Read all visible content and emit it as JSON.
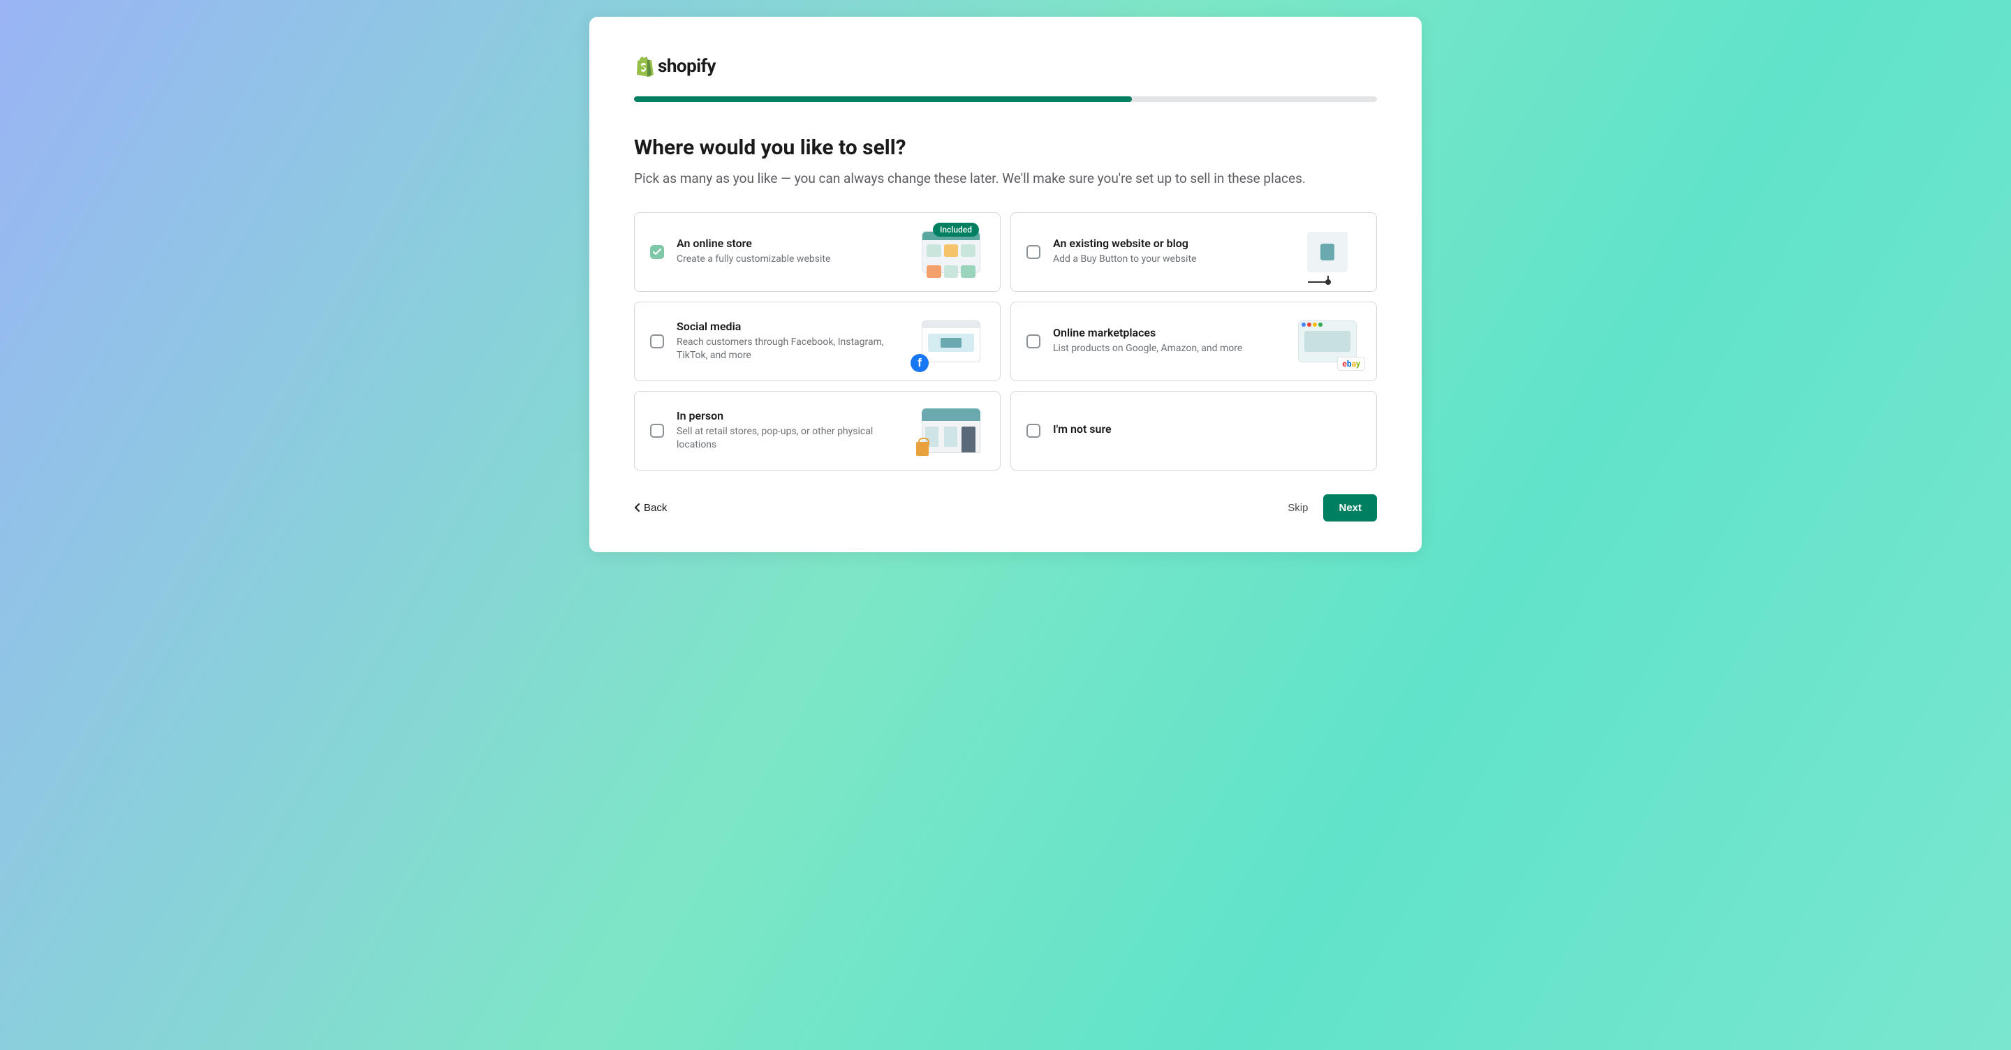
{
  "brand": "shopify",
  "progress_percent": 67,
  "heading": "Where would you like to sell?",
  "subheading": "Pick as many as you like — you can always change these later. We'll make sure you're set up to sell in these places.",
  "options": [
    {
      "title": "An online store",
      "desc": "Create a fully customizable website",
      "checked": true,
      "badge": "Included"
    },
    {
      "title": "An existing website or blog",
      "desc": "Add a Buy Button to your website",
      "checked": false
    },
    {
      "title": "Social media",
      "desc": "Reach customers through Facebook, Instagram, TikTok, and more",
      "checked": false
    },
    {
      "title": "Online marketplaces",
      "desc": "List products on Google, Amazon, and more",
      "checked": false
    },
    {
      "title": "In person",
      "desc": "Sell at retail stores, pop-ups, or other physical locations",
      "checked": false
    },
    {
      "title": "I'm not sure",
      "desc": "",
      "checked": false
    }
  ],
  "footer": {
    "back": "Back",
    "skip": "Skip",
    "next": "Next"
  },
  "ebay_label": "ebay"
}
